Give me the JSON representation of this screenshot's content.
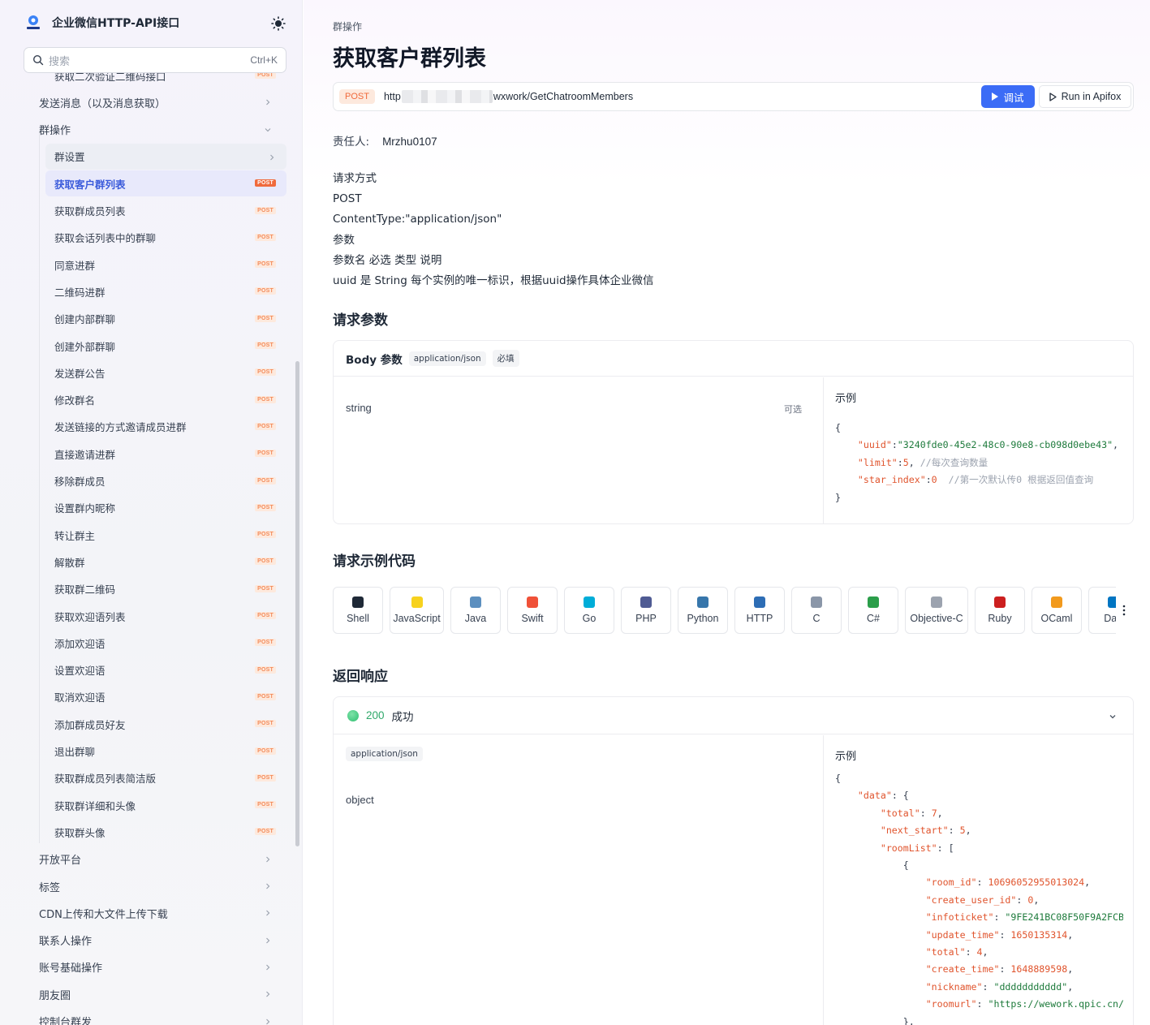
{
  "app": {
    "title": "企业微信HTTP-API接口"
  },
  "search": {
    "placeholder": "搜索",
    "shortcut": "Ctrl+K"
  },
  "nav": {
    "cut_item": {
      "label": "获取二次验证二维码接口",
      "badge": "POST"
    },
    "groups_before": [
      {
        "label": "发送消息（以及消息获取）"
      }
    ],
    "open_group": {
      "label": "群操作",
      "items": [
        {
          "label": "群设置",
          "badge": "",
          "state": "hover"
        },
        {
          "label": "获取客户群列表",
          "badge": "POST",
          "state": "active"
        },
        {
          "label": "获取群成员列表",
          "badge": "POST"
        },
        {
          "label": "获取会话列表中的群聊",
          "badge": "POST"
        },
        {
          "label": "同意进群",
          "badge": "POST"
        },
        {
          "label": "二维码进群",
          "badge": "POST"
        },
        {
          "label": "创建内部群聊",
          "badge": "POST"
        },
        {
          "label": "创建外部群聊",
          "badge": "POST"
        },
        {
          "label": "发送群公告",
          "badge": "POST"
        },
        {
          "label": "修改群名",
          "badge": "POST"
        },
        {
          "label": "发送链接的方式邀请成员进群",
          "badge": "POST"
        },
        {
          "label": "直接邀请进群",
          "badge": "POST"
        },
        {
          "label": "移除群成员",
          "badge": "POST"
        },
        {
          "label": "设置群内昵称",
          "badge": "POST"
        },
        {
          "label": "转让群主",
          "badge": "POST"
        },
        {
          "label": "解散群",
          "badge": "POST"
        },
        {
          "label": "获取群二维码",
          "badge": "POST"
        },
        {
          "label": "获取欢迎语列表",
          "badge": "POST"
        },
        {
          "label": "添加欢迎语",
          "badge": "POST"
        },
        {
          "label": "设置欢迎语",
          "badge": "POST"
        },
        {
          "label": "取消欢迎语",
          "badge": "POST"
        },
        {
          "label": "添加群成员好友",
          "badge": "POST"
        },
        {
          "label": "退出群聊",
          "badge": "POST"
        },
        {
          "label": "获取群成员列表简洁版",
          "badge": "POST"
        },
        {
          "label": "获取群详细和头像",
          "badge": "POST"
        },
        {
          "label": "获取群头像",
          "badge": "POST"
        }
      ]
    },
    "groups_after": [
      {
        "label": "开放平台"
      },
      {
        "label": "标签"
      },
      {
        "label": "CDN上传和大文件上传下载"
      },
      {
        "label": "联系人操作"
      },
      {
        "label": "账号基础操作"
      },
      {
        "label": "朋友圈"
      },
      {
        "label": "控制台群发"
      }
    ]
  },
  "page": {
    "breadcrumb": "群操作",
    "title": "获取客户群列表",
    "method": "POST",
    "url_prefix": "http",
    "url_suffix": "wxwork/GetChatroomMembers",
    "debug_label": "调试",
    "apifox_label": "Run in Apifox",
    "owner_label": "责任人:",
    "owner_value": "Mrzhu0107",
    "desc_lines": [
      "请求方式",
      "POST",
      "ContentType:\"application/json\"",
      "参数",
      "参数名 必选 类型 说明",
      "uuid 是 String 每个实例的唯一标识，根据uuid操作具体企业微信"
    ]
  },
  "request": {
    "heading": "请求参数",
    "body_title": "Body 参数",
    "content_type": "application/json",
    "required_tag": "必填",
    "field_type": "string",
    "optional_label": "可选",
    "example_label": "示例",
    "example": {
      "uuid": "3240fde0-45e2-48c0-90e8-cb098d0ebe43",
      "limit": "5",
      "limit_comment": "//每次查询数量",
      "star_index": "0",
      "star_index_comment": "//第一次默认传0 根据返回值查询"
    }
  },
  "code_samples": {
    "heading": "请求示例代码",
    "langs": [
      {
        "label": "Shell",
        "icon": "terminal-icon",
        "color": "#1f2937"
      },
      {
        "label": "JavaScript",
        "icon": "js-icon",
        "color": "#f7d21e"
      },
      {
        "label": "Java",
        "icon": "java-icon",
        "color": "#5c8fbf"
      },
      {
        "label": "Swift",
        "icon": "swift-icon",
        "color": "#f05138"
      },
      {
        "label": "Go",
        "icon": "go-icon",
        "color": "#00add8"
      },
      {
        "label": "PHP",
        "icon": "php-icon",
        "color": "#4f5b93"
      },
      {
        "label": "Python",
        "icon": "python-icon",
        "color": "#3776ab"
      },
      {
        "label": "HTTP",
        "icon": "http-icon",
        "color": "#2d6db5"
      },
      {
        "label": "C",
        "icon": "c-icon",
        "color": "#8a96a8"
      },
      {
        "label": "C#",
        "icon": "csharp-icon",
        "color": "#2b9e4a"
      },
      {
        "label": "Objective-C",
        "icon": "objc-icon",
        "color": "#9ca3af"
      },
      {
        "label": "Ruby",
        "icon": "ruby-icon",
        "color": "#cc1f1f"
      },
      {
        "label": "OCaml",
        "icon": "ocaml-icon",
        "color": "#f29a1d"
      },
      {
        "label": "Dart",
        "icon": "dart-icon",
        "color": "#0175c2"
      }
    ]
  },
  "response": {
    "heading": "返回响应",
    "status_code": "200",
    "status_text": "成功",
    "content_type": "application/json",
    "field_type": "object",
    "example_label": "示例",
    "example": {
      "total": "7",
      "next_start": "5",
      "room_id": "10696052955013024",
      "create_user_id": "0",
      "infoticket": "\"9FE241BC08F50F9A2FCB",
      "update_time": "1650135314",
      "room_total": "4",
      "create_time": "1648889598",
      "nickname": "\"ddddddddddd\"",
      "roomurl": "\"https://wework.qpic.cn/"
    }
  }
}
